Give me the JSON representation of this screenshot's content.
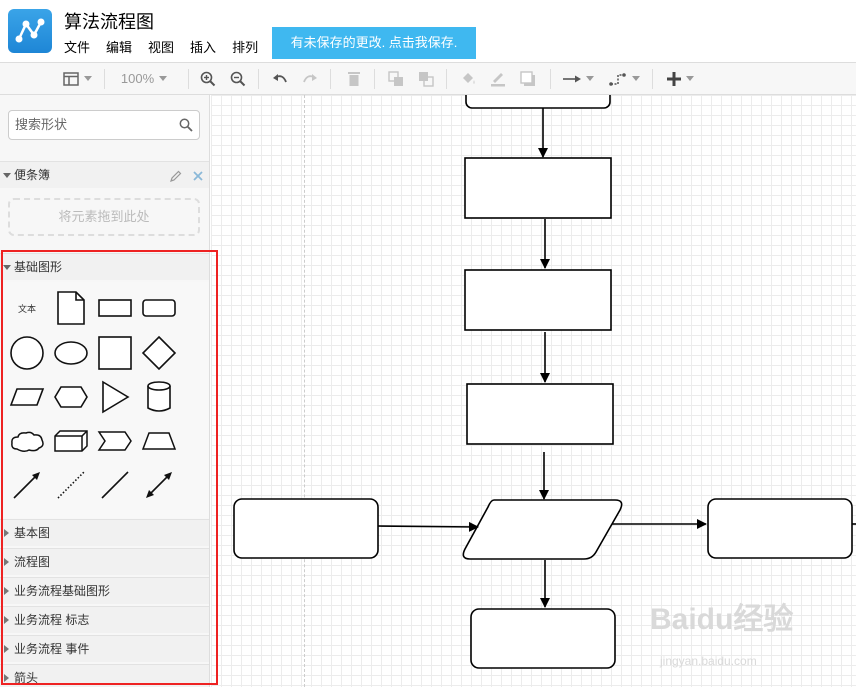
{
  "app": {
    "title": "算法流程图",
    "menu": [
      "文件",
      "编辑",
      "视图",
      "插入",
      "排列"
    ],
    "save_banner": "有未保存的更改. 点击我保存."
  },
  "toolbar": {
    "zoom": "100%"
  },
  "sidebar": {
    "search_placeholder": "搜索形状",
    "scratchpad_title": "便条簿",
    "dropzone_text": "将元素拖到此处",
    "basic_shapes_title": "基础图形",
    "text_shape_label": "文本",
    "collapsed_sections": [
      "基本图",
      "流程图",
      "业务流程基础图形",
      "业务流程 标志",
      "业务流程 事件",
      "箭头"
    ]
  },
  "watermark": {
    "brand": "Baidu经验",
    "url": "jingyan.baidu.com"
  }
}
